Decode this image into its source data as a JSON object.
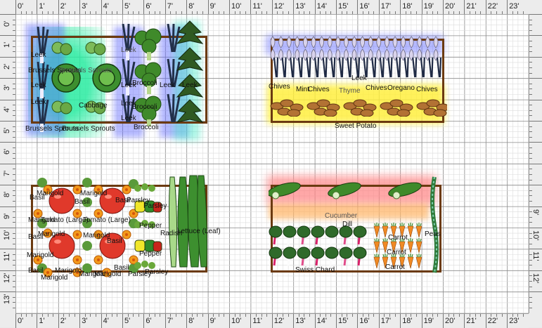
{
  "rulers": {
    "top_labels": [
      "0'",
      "1'",
      "2'",
      "3'",
      "4'",
      "5'",
      "6'",
      "7'",
      "8'",
      "9'",
      "10'",
      "11'",
      "12'",
      "13'",
      "14'",
      "15'",
      "16'",
      "17'",
      "18'",
      "19'",
      "20'",
      "21'",
      "22'",
      "23'"
    ],
    "left_labels": [
      "0'",
      "1'",
      "2'",
      "3'",
      "4'",
      "5'",
      "6'",
      "7'",
      "8'",
      "9'",
      "10'",
      "11'",
      "12'",
      "13'"
    ],
    "right_labels": [
      "9'",
      "10'",
      "11'",
      "12'"
    ]
  },
  "beds": [
    {
      "name": "bed-brassica"
    },
    {
      "name": "bed-herbs"
    },
    {
      "name": "bed-tomato"
    },
    {
      "name": "bed-chard"
    }
  ],
  "labels": {
    "bed1": [
      "Leek",
      "Leek",
      "Brussels Sprouts",
      "Brussels Sprouts",
      "Leek",
      "Leek",
      "Leek",
      "Brussels Sprouts",
      "Brussels Sprouts",
      "Cabbage",
      "Leek",
      "Broccoli",
      "Leek",
      "Broccoli",
      "Broccoli",
      "Leek",
      "Leek"
    ],
    "bed2": [
      "Chives",
      "Mint",
      "Chives",
      "Thyme",
      "Leek",
      "Chives",
      "Oregano",
      "Chives",
      "Sweet Potato"
    ],
    "bed3": [
      "Basil",
      "Marigold",
      "Marigold",
      "Basil",
      "Basil",
      "Parsley",
      "Parsley",
      "Marigold",
      "Tomato (Large)",
      "Tomato (Large)",
      "Pepper",
      "Radish",
      "Lettuce (Leaf)",
      "Basil",
      "Marigold",
      "Marigold",
      "Basil",
      "Pepper",
      "Marigold",
      "Basil",
      "Marigold",
      "Marigold",
      "Parsley",
      "Parsley",
      "Marigold",
      "Marigold",
      "Basil"
    ],
    "bed4": [
      "Cucumber",
      "Dill",
      "Carrot",
      "Carrot",
      "Peas",
      "Swiss Chard",
      "Carrot"
    ]
  },
  "icons": [
    "brussels-sprouts-icon",
    "cabbage-icon",
    "broccoli-icon",
    "leek-icon",
    "kale-icon",
    "onion-icon",
    "chives-icon",
    "sweet-potato-icon",
    "tomato-icon",
    "marigold-icon",
    "pepper-icon",
    "parsley-icon",
    "lettuce-icon",
    "cucumber-icon",
    "swiss-chard-icon",
    "carrot-icon",
    "peas-icon"
  ],
  "colors": {
    "bed_border": "#6b3a10",
    "grid_major": "#888888",
    "grid_minor": "#d8d8d8",
    "highlight_green": "#49e8a6",
    "highlight_blue": "#5a6cff",
    "highlight_yellow": "#ffee40",
    "highlight_pink": "#ff9a9a",
    "highlight_orange": "#ffbb70"
  }
}
